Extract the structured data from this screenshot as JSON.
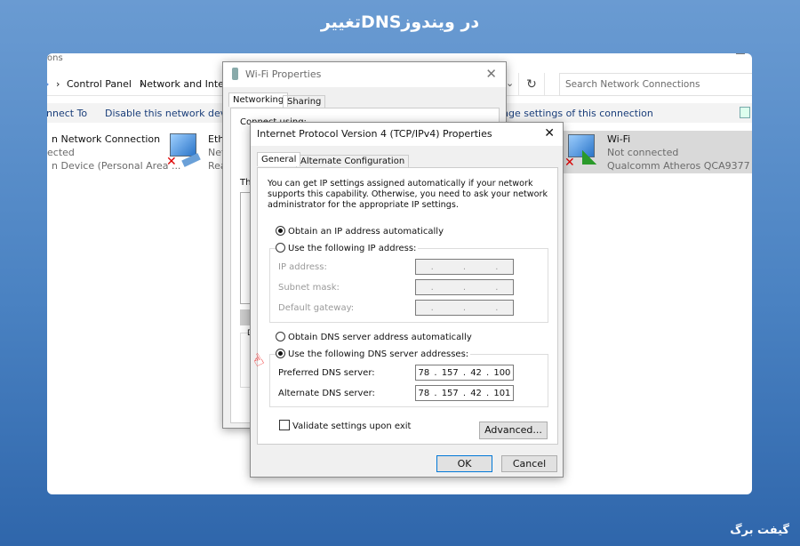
{
  "banner": {
    "title": "تغییرDNSدر ویندوز",
    "brand": "گیفت برگ"
  },
  "explorer": {
    "window_title_fragment": "ons",
    "breadcrumb": [
      "Control Panel",
      "Network and Interne"
    ],
    "search_placeholder": "Search Network Connections",
    "toolbar": {
      "connect_to": "nnect To",
      "disable": "Disable this network device",
      "change_settings": "nge settings of this connection"
    },
    "connections": [
      {
        "name": "n Network Connection",
        "status": "ected",
        "device": "n Device (Personal Area ..."
      },
      {
        "name": "Ethe",
        "status": "Net",
        "device": "Rea"
      },
      {
        "name": "Wi-Fi",
        "status": "Not connected",
        "device": "Qualcomm Atheros QCA9377 Wir..."
      }
    ]
  },
  "wifi_props": {
    "title": "Wi-Fi Properties",
    "tabs": [
      "Networking",
      "Sharing"
    ],
    "connect_using": "Connect using:",
    "this_uses": "Th",
    "desc_label": "D"
  },
  "ipv4": {
    "title": "Internet Protocol Version 4 (TCP/IPv4) Properties",
    "tabs": [
      "General",
      "Alternate Configuration"
    ],
    "intro": "You can get IP settings assigned automatically if your network supports this capability. Otherwise, you need to ask your network administrator for the appropriate IP settings.",
    "obtain_ip_auto": "Obtain an IP address automatically",
    "use_ip": "Use the following IP address:",
    "ip_address": "IP address:",
    "subnet_mask": "Subnet mask:",
    "default_gateway": "Default gateway:",
    "obtain_dns_auto": "Obtain DNS server address automatically",
    "use_dns": "Use the following DNS server addresses:",
    "preferred_dns_label": "Preferred DNS server:",
    "preferred_dns": [
      "78",
      "157",
      "42",
      "100"
    ],
    "alternate_dns_label": "Alternate DNS server:",
    "alternate_dns": [
      "78",
      "157",
      "42",
      "101"
    ],
    "validate": "Validate settings upon exit",
    "advanced": "Advanced...",
    "ok": "OK",
    "cancel": "Cancel",
    "selected_ip_option": "obtain_ip_auto",
    "selected_dns_option": "use_dns",
    "validate_checked": false
  }
}
